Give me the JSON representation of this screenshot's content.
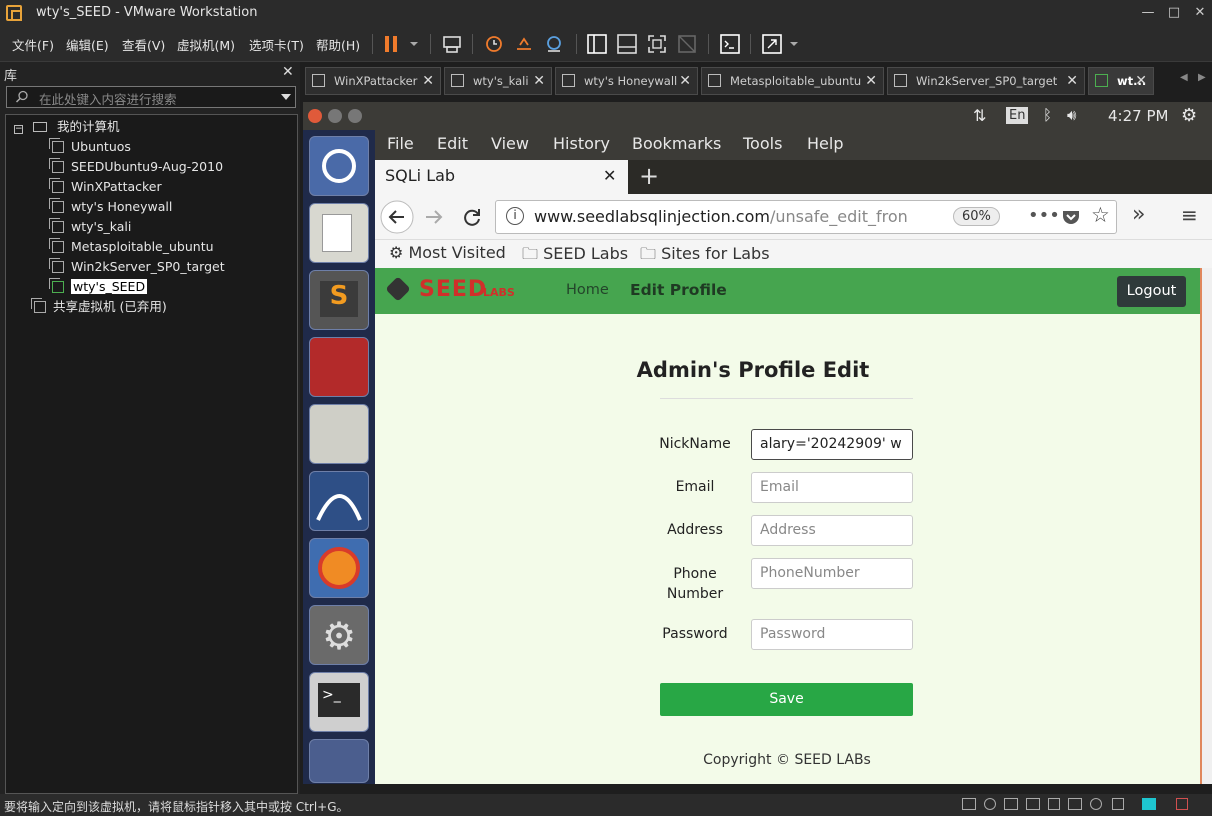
{
  "window": {
    "title": "wty's_SEED - VMware Workstation"
  },
  "vm_menu": [
    "文件(F)",
    "编辑(E)",
    "查看(V)",
    "虚拟机(M)",
    "选项卡(T)",
    "帮助(H)"
  ],
  "library": {
    "title": "库",
    "search_placeholder": "在此处键入内容进行搜索",
    "root": "我的计算机",
    "items": [
      "Ubuntuos",
      "SEEDUbuntu9-Aug-2010",
      "WinXPattacker",
      "wty's Honeywall",
      "wty's_kali",
      "Metasploitable_ubuntu",
      "Win2kServer_SP0_target",
      "wty's_SEED"
    ],
    "shared": "共享虚拟机 (已弃用)"
  },
  "tabs": [
    "WinXPattacker",
    "wty's_kali",
    "wty's Honeywall",
    "Metasploitable_ubuntu",
    "Win2kServer_SP0_target",
    "wt..."
  ],
  "ubuntu_panel": {
    "lang": "En",
    "time": "4:27 PM"
  },
  "firefox": {
    "menu": [
      "File",
      "Edit",
      "View",
      "History",
      "Bookmarks",
      "Tools",
      "Help"
    ],
    "tab_title": "SQLi Lab",
    "url_host": "www.seedlabsqlinjection.com",
    "url_path": "/unsafe_edit_fron",
    "zoom": "60%",
    "bookmarks": [
      "Most Visited",
      "SEED Labs",
      "Sites for Labs"
    ]
  },
  "site": {
    "logo_text": "SEED",
    "logo_sub": "LABS",
    "nav_home": "Home",
    "nav_edit": "Edit Profile",
    "logout": "Logout",
    "heading": "Admin's Profile Edit",
    "fields": {
      "nickname_label": "NickName",
      "nickname_value": "alary='20242909' w",
      "email_label": "Email",
      "email_ph": "Email",
      "address_label": "Address",
      "address_ph": "Address",
      "phone_label_1": "Phone",
      "phone_label_2": "Number",
      "phone_ph": "PhoneNumber",
      "password_label": "Password",
      "password_ph": "Password"
    },
    "save": "Save",
    "copyright": "Copyright © SEED LABs"
  },
  "status": {
    "text": "要将输入定向到该虚拟机，请将鼠标指针移入其中或按 Ctrl+G。"
  },
  "colors": {
    "site_green": "#46a54f",
    "save_green": "#28a745",
    "page_bg": "#f3fbe9"
  }
}
